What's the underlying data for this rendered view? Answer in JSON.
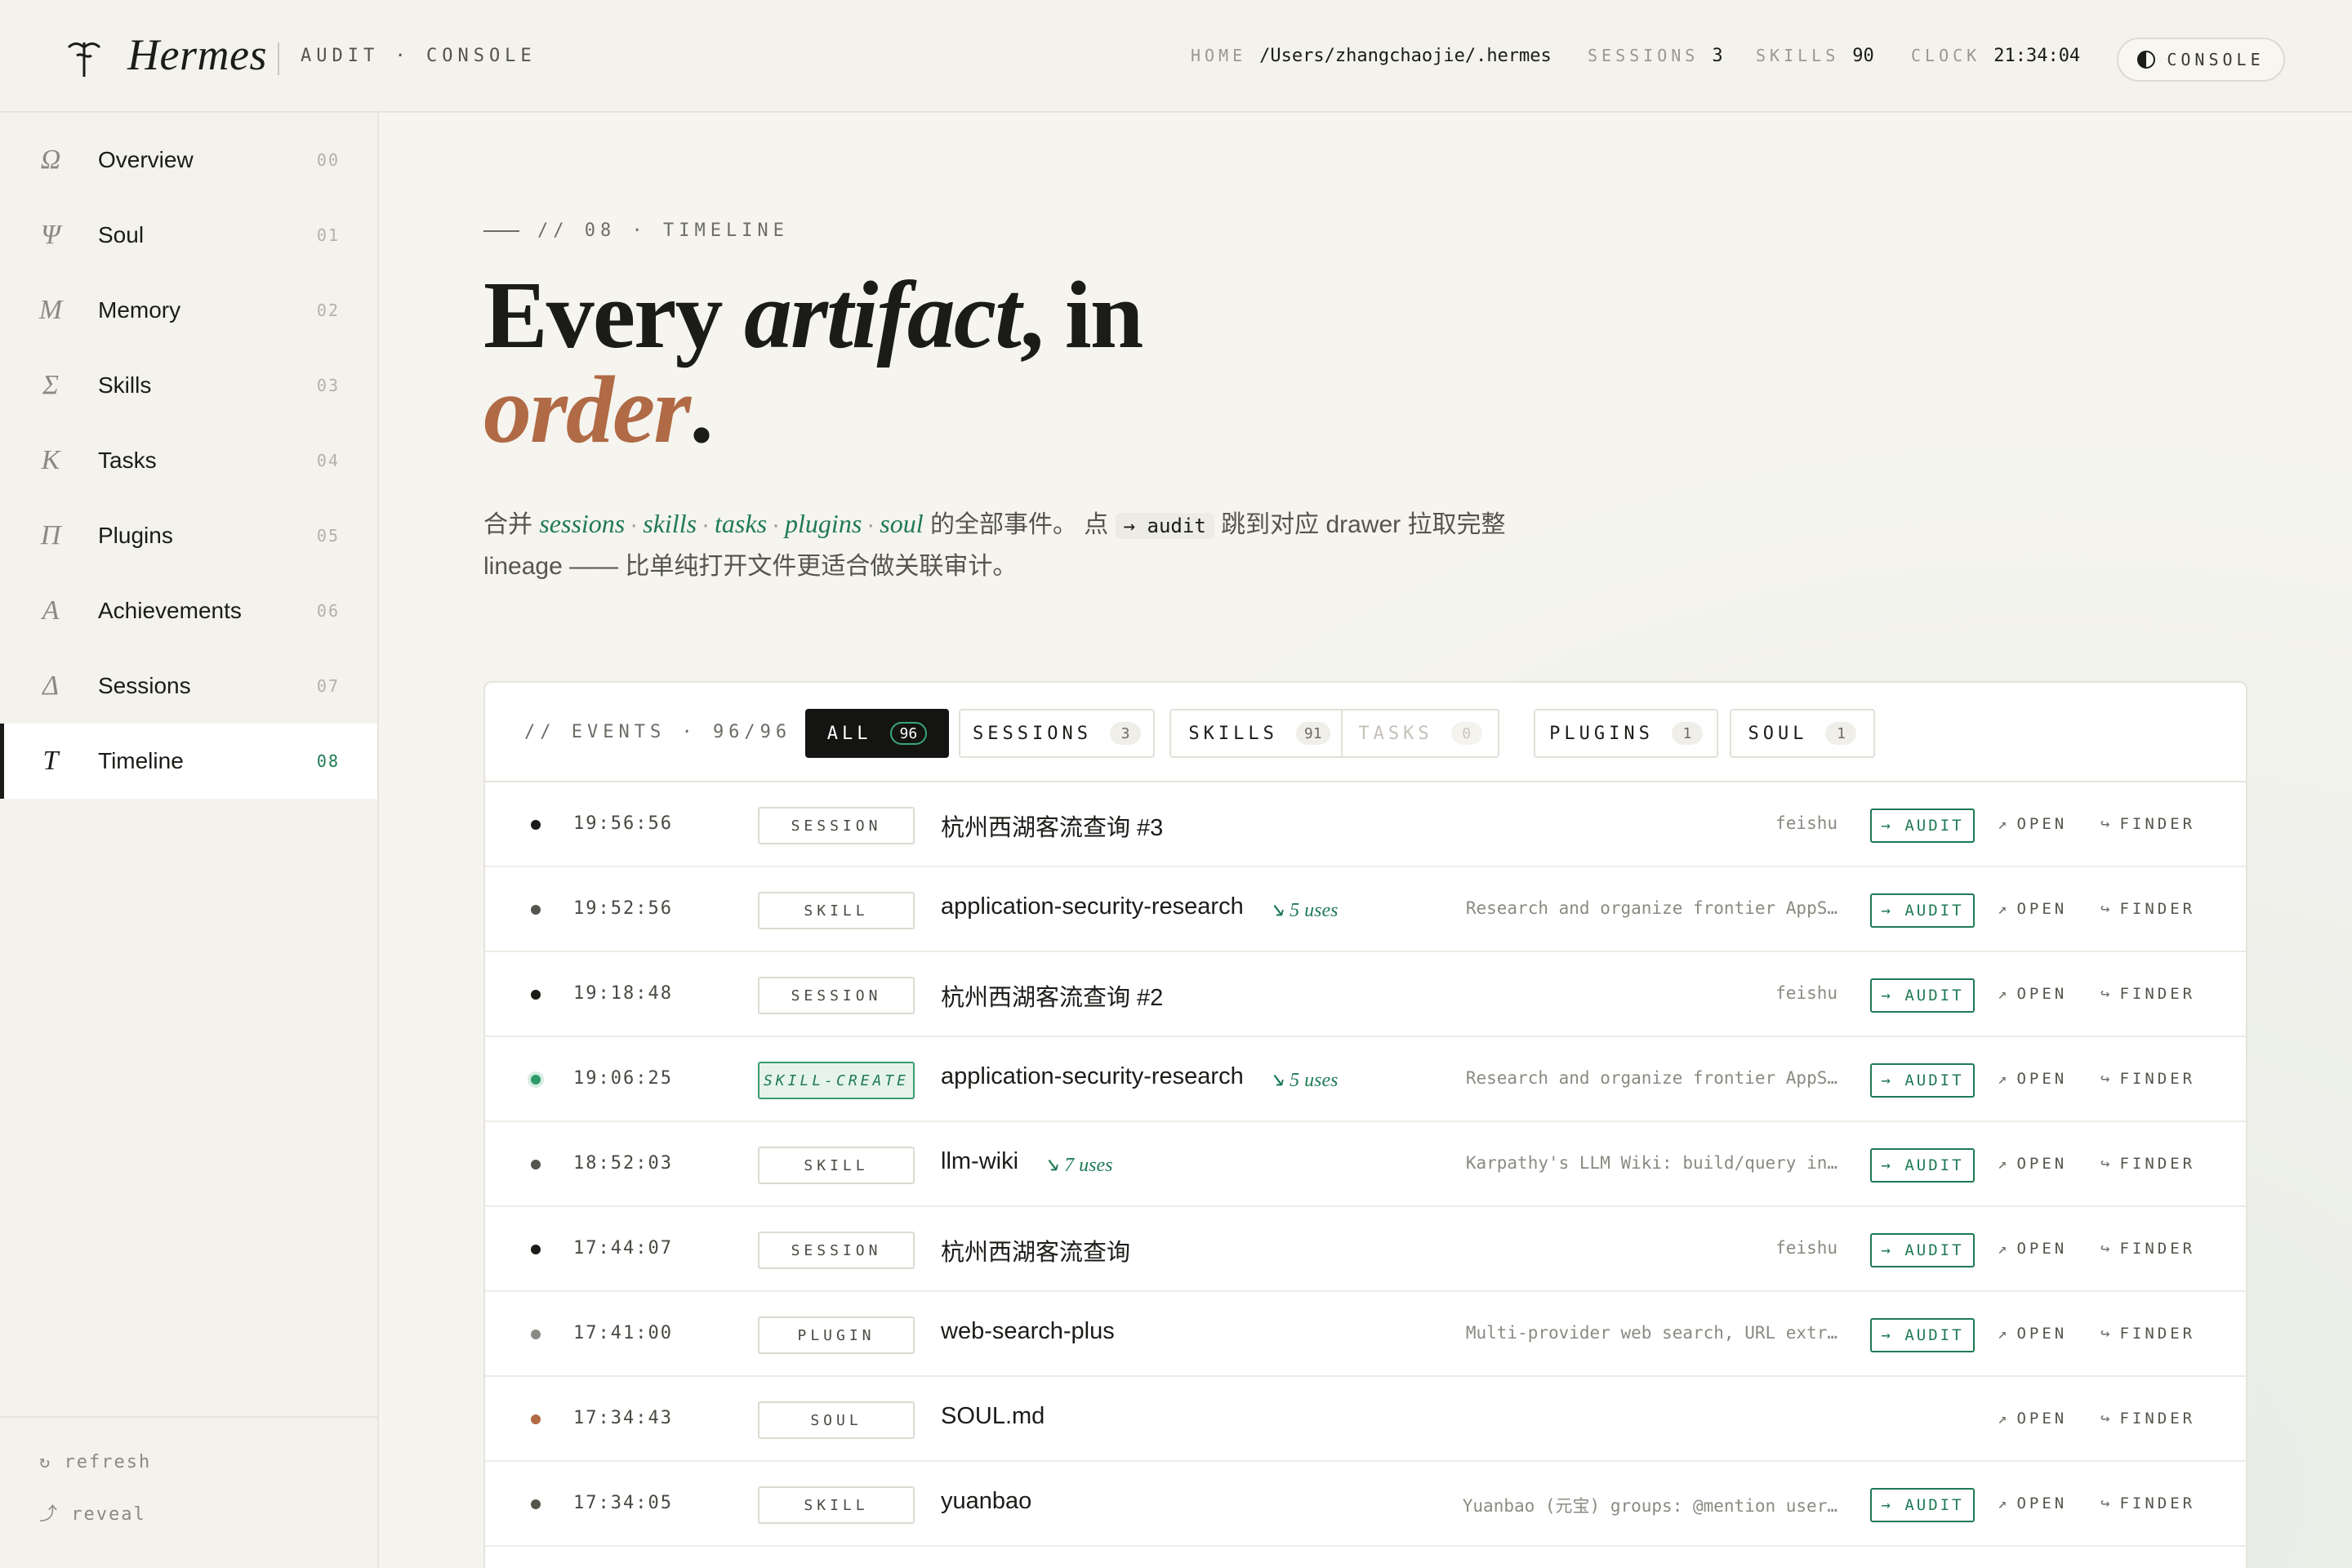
{
  "brand": {
    "name": "Hermes",
    "subtitle": "AUDIT · CONSOLE"
  },
  "header_stats": [
    {
      "key": "HOME",
      "value": "/Users/zhangchaojie/.hermes"
    },
    {
      "key": "SESSIONS",
      "value": "3"
    },
    {
      "key": "SKILLS",
      "value": "90"
    },
    {
      "key": "CLOCK",
      "value": "21:34:04"
    }
  ],
  "console_button": {
    "label": "CONSOLE",
    "icon": "half-circle-icon"
  },
  "nav": [
    {
      "glyph": "Ω",
      "label": "Overview",
      "num": "00",
      "active": false
    },
    {
      "glyph": "Ψ",
      "label": "Soul",
      "num": "01",
      "active": false
    },
    {
      "glyph": "M",
      "label": "Memory",
      "num": "02",
      "active": false
    },
    {
      "glyph": "Σ",
      "label": "Skills",
      "num": "03",
      "active": false
    },
    {
      "glyph": "K",
      "label": "Tasks",
      "num": "04",
      "active": false
    },
    {
      "glyph": "Π",
      "label": "Plugins",
      "num": "05",
      "active": false
    },
    {
      "glyph": "A",
      "label": "Achievements",
      "num": "06",
      "active": false
    },
    {
      "glyph": "Δ",
      "label": "Sessions",
      "num": "07",
      "active": false
    },
    {
      "glyph": "T",
      "label": "Timeline",
      "num": "08",
      "active": true
    }
  ],
  "sidebar_footer": {
    "refresh": "↻ refresh",
    "reveal": "⤴ reveal"
  },
  "page": {
    "eyebrow": "// 08 · TIMELINE",
    "headline": {
      "part1": "Every ",
      "italic": "artifact",
      "part2": ", in",
      "accent": "order",
      "end": "."
    },
    "lede": {
      "prefix": "合并 ",
      "tags": [
        "sessions",
        "skills",
        "tasks",
        "plugins",
        "soul"
      ],
      "middle": " 的全部事件。 点 ",
      "code": "→ audit",
      "suffix": " 跳到对应 drawer 拉取完整 lineage —— 比单纯打开文件更适合做关联审计。"
    }
  },
  "events": {
    "title": "// EVENTS · 96/96",
    "filters": [
      {
        "label": "ALL",
        "count": "96",
        "state": "active"
      },
      {
        "label": "SESSIONS",
        "count": "3",
        "state": "normal"
      },
      {
        "label": "SKILLS",
        "count": "91",
        "state": "normal"
      },
      {
        "label": "TASKS",
        "count": "0",
        "state": "disabled"
      },
      {
        "label": "PLUGINS",
        "count": "1",
        "state": "normal"
      },
      {
        "label": "SOUL",
        "count": "1",
        "state": "normal"
      }
    ],
    "actions": {
      "audit": "→ AUDIT",
      "open": "OPEN",
      "finder": "FINDER",
      "open_icon": "↗",
      "finder_icon": "↪"
    },
    "rows": [
      {
        "time": "19:56:56",
        "type": "SESSION",
        "title": "杭州西湖客流查询 #3",
        "uses": "",
        "desc": "feishu",
        "audit": true,
        "dot": "#1b1b18"
      },
      {
        "time": "19:52:56",
        "type": "SKILL",
        "title": "application-security-research",
        "uses": "↘ 5 uses",
        "desc": "Research and organize frontier AppS…",
        "audit": true,
        "dot": "#55544d"
      },
      {
        "time": "19:18:48",
        "type": "SESSION",
        "title": "杭州西湖客流查询 #2",
        "uses": "",
        "desc": "feishu",
        "audit": true,
        "dot": "#1b1b18"
      },
      {
        "time": "19:06:25",
        "type": "SKILL-CREATE",
        "title": "application-security-research",
        "uses": "↘ 5 uses",
        "desc": "Research and organize frontier AppS…",
        "audit": true,
        "dot": "#2e9a6c"
      },
      {
        "time": "18:52:03",
        "type": "SKILL",
        "title": "llm-wiki",
        "uses": "↘ 7 uses",
        "desc": "Karpathy's LLM Wiki: build/query in…",
        "audit": true,
        "dot": "#55544d"
      },
      {
        "time": "17:44:07",
        "type": "SESSION",
        "title": "杭州西湖客流查询",
        "uses": "",
        "desc": "feishu",
        "audit": true,
        "dot": "#1b1b18"
      },
      {
        "time": "17:41:00",
        "type": "PLUGIN",
        "title": "web-search-plus",
        "uses": "",
        "desc": "Multi-provider web search, URL extr…",
        "audit": true,
        "dot": "#8b8a82"
      },
      {
        "time": "17:34:43",
        "type": "SOUL",
        "title": "SOUL.md",
        "uses": "",
        "desc": "",
        "audit": false,
        "dot": "#b06a45"
      },
      {
        "time": "17:34:05",
        "type": "SKILL",
        "title": "yuanbao",
        "uses": "",
        "desc": "Yuanbao (元宝) groups: @mention user…",
        "audit": true,
        "dot": "#55544d"
      }
    ]
  }
}
